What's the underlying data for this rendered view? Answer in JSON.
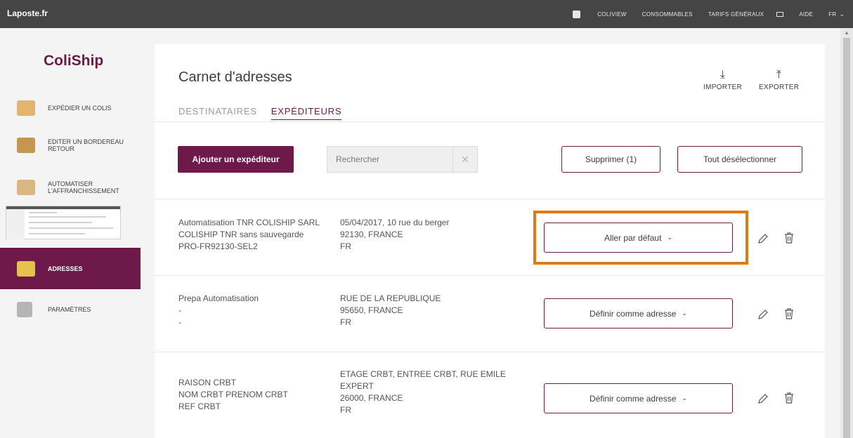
{
  "topbar": {
    "home_link": "Laposte.fr",
    "nav": [
      "COLIVIEW",
      "CONSOMMABLES",
      "TARIFS GÉNÉRAUX"
    ],
    "help": "AIDE",
    "lang": "FR"
  },
  "sidebar": {
    "brand": "ColiShip",
    "items": [
      {
        "label": "EXPÉDIER UN COLIS",
        "icon": "package-icon"
      },
      {
        "label": "EDITER UN BORDEREAU RETOUR",
        "icon": "return-package-icon"
      },
      {
        "label": "AUTOMATISER L'AFFRANCHISSEMENT",
        "icon": "automation-icon"
      },
      {
        "label": "ADRESSES",
        "icon": "address-book-icon"
      },
      {
        "label": "PARAMÈTRES",
        "icon": "gear-icon"
      }
    ]
  },
  "main": {
    "title": "Carnet d'adresses",
    "import_label": "IMPORTER",
    "export_label": "EXPORTER",
    "tabs": [
      {
        "label": "DESTINATAIRES",
        "active": false
      },
      {
        "label": "EXPÉDITEURS",
        "active": true
      }
    ],
    "add_button": "Ajouter un expéditeur",
    "search_placeholder": "Rechercher",
    "delete_button": "Supprimer (1)",
    "deselect_button": "Tout désélectionner"
  },
  "rows": [
    {
      "name": [
        "Automatisation TNR COLISHIP SARL",
        "COLISHIP TNR sans sauvegarde",
        "PRO-FR92130-SEL2"
      ],
      "address": [
        "05/04/2017, 10 rue du berger",
        "92130, FRANCE",
        "FR"
      ],
      "action": "Aller par défaut"
    },
    {
      "name": [
        "Prepa Automatisation",
        "-",
        "-"
      ],
      "address": [
        "RUE DE LA REPUBLIQUE",
        "95650, FRANCE",
        "FR"
      ],
      "action": "Définir comme adresse"
    },
    {
      "name": [
        "RAISON CRBT",
        "NOM CRBT PRENOM CRBT",
        "REF CRBT"
      ],
      "address": [
        "ETAGE CRBT, ENTREE CRBT, RUE EMILE",
        "EXPERT",
        "26000, FRANCE",
        "FR"
      ],
      "action": "Définir comme adresse"
    }
  ],
  "colors": {
    "brand": "#6d1a4a",
    "topbar": "#454545",
    "highlight": "#e07a16"
  }
}
